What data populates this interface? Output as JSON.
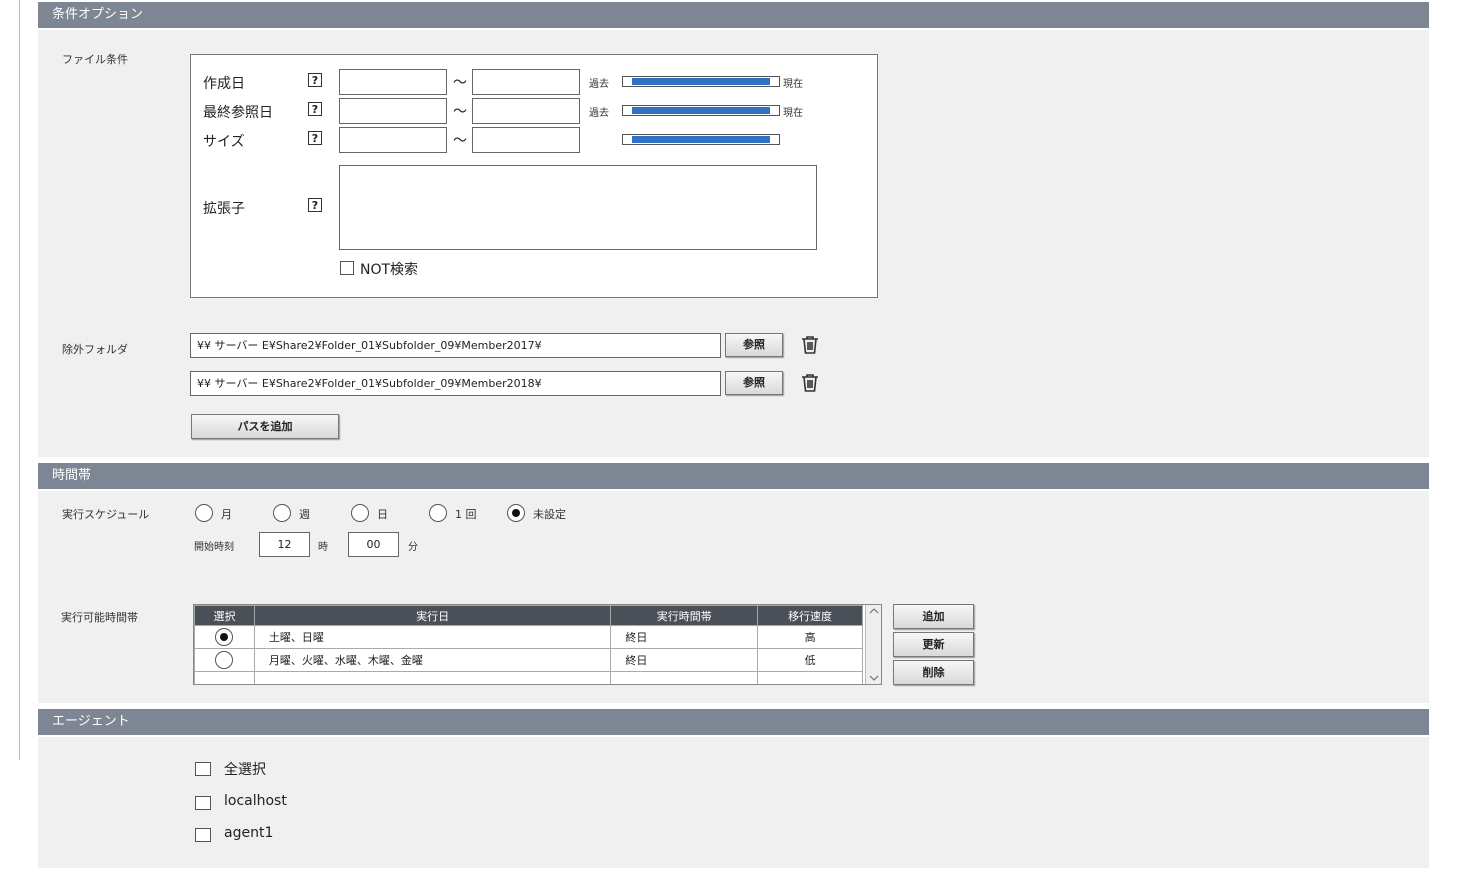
{
  "sections": {
    "conditions": "条件オプション",
    "time": "時間帯",
    "agent": "エージェント"
  },
  "file_conditions": {
    "label": "ファイル条件",
    "created": "作成日",
    "last_ref": "最終参照日",
    "size": "サイズ",
    "ext": "拡張子",
    "help": "?",
    "tilde": "～",
    "past": "過去",
    "now": "現在",
    "not_search": "NOT検索",
    "created_from": "",
    "created_to": "",
    "lastref_from": "",
    "lastref_to": "",
    "size_from": "",
    "size_to": "",
    "ext_value": "",
    "created_range": [
      0,
      1
    ],
    "lastref_range": [
      0,
      1
    ],
    "size_range": [
      0,
      1
    ],
    "slider_color": "#2f72c4"
  },
  "exclude": {
    "label": "除外フォルダ",
    "paths": [
      "¥¥ サーバー E¥Share2¥Folder_01¥Subfolder_09¥Member2017¥",
      "¥¥ サーバー E¥Share2¥Folder_01¥Subfolder_09¥Member2018¥"
    ],
    "browse": "参照",
    "add_path": "パスを追加"
  },
  "schedule": {
    "label": "実行スケジュール",
    "options": [
      "月",
      "週",
      "日",
      "1 回",
      "未設定"
    ],
    "selected": "未設定",
    "start_label": "開始時刻",
    "hour": "12",
    "hour_unit": "時",
    "minute": "00",
    "minute_unit": "分"
  },
  "timeslots": {
    "label": "実行可能時間帯",
    "headers": [
      "選択",
      "実行日",
      "実行時間帯",
      "移行速度"
    ],
    "rows": [
      {
        "selected": true,
        "days": "土曜、日曜",
        "time": "終日",
        "speed": "高"
      },
      {
        "selected": false,
        "days": "月曜、火曜、水曜、木曜、金曜",
        "time": "終日",
        "speed": "低"
      }
    ],
    "add": "追加",
    "update": "更新",
    "delete": "削除"
  },
  "agents": {
    "items": [
      "全選択",
      "localhost",
      "agent1"
    ]
  },
  "colors": {
    "header_bg": "#7e8593",
    "panel_bg": "#f0f0f0",
    "table_header_bg": "#4a4f58",
    "slider_fill": "#2f72c4"
  }
}
